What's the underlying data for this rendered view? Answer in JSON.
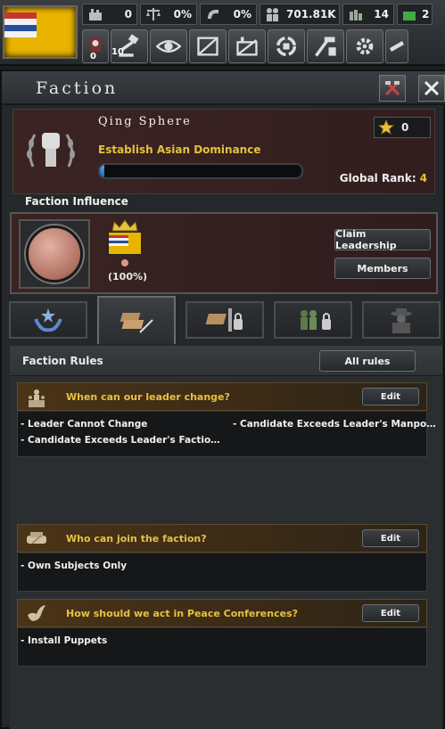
{
  "topbar": {
    "resources": [
      {
        "icon": "factory-icon",
        "value": "0"
      },
      {
        "icon": "scales-icon",
        "value": "0%"
      },
      {
        "icon": "horn-icon",
        "value": "0%"
      },
      {
        "icon": "manpower-icon",
        "value": "701.81K"
      },
      {
        "icon": "civilian-factory-icon",
        "value": "14"
      },
      {
        "icon": "military-factory-icon",
        "value": "2"
      }
    ],
    "buttons": [
      {
        "icon": "decision-icon",
        "badge": "0"
      },
      {
        "icon": "gavel-icon",
        "badge": "10"
      },
      {
        "icon": "eye-icon",
        "badge": ""
      },
      {
        "icon": "research-icon",
        "badge": ""
      },
      {
        "icon": "trade-icon",
        "badge": ""
      },
      {
        "icon": "logistics-icon",
        "badge": ""
      },
      {
        "icon": "construction-icon",
        "badge": ""
      },
      {
        "icon": "production-icon",
        "badge": ""
      },
      {
        "icon": "army-icon",
        "badge": ""
      }
    ]
  },
  "panel": {
    "title": "Faction",
    "faction_name": "Qing Sphere",
    "goal": "Establish Asian Dominance",
    "goal_progress": 0.02,
    "stars": "0",
    "global_rank_label": "Global Rank:",
    "global_rank_value": "4"
  },
  "influence": {
    "label": "Faction Influence",
    "leader_share": "(100%)",
    "claim_leadership": "Claim Leadership",
    "members": "Members"
  },
  "tabs": [
    {
      "icon": "laurel-star-icon",
      "locked": false,
      "active": false
    },
    {
      "icon": "documents-icon",
      "locked": false,
      "active": true
    },
    {
      "icon": "map-pin-icon",
      "locked": true,
      "active": false
    },
    {
      "icon": "soldiers-icon",
      "locked": true,
      "active": false
    },
    {
      "icon": "spy-icon",
      "locked": false,
      "active": false
    }
  ],
  "rules": {
    "title": "Faction Rules",
    "all_rules": "All rules",
    "edit": "Edit",
    "items": [
      {
        "question": "When can our leader change?",
        "options": [
          "- Leader Cannot Change",
          "- Candidate Exceeds Leader's Manpo…",
          "- Candidate Exceeds Leader's Factio…"
        ]
      },
      {
        "question": "Who can join the faction?",
        "options": [
          "- Own Subjects Only"
        ]
      },
      {
        "question": "How should we act in Peace Conferences?",
        "options": [
          "- Install Puppets"
        ]
      }
    ]
  },
  "colors": {
    "gold_text": "#e6c23a",
    "flag_yellow": "#e8b400",
    "panel_red": "#3b2323"
  }
}
